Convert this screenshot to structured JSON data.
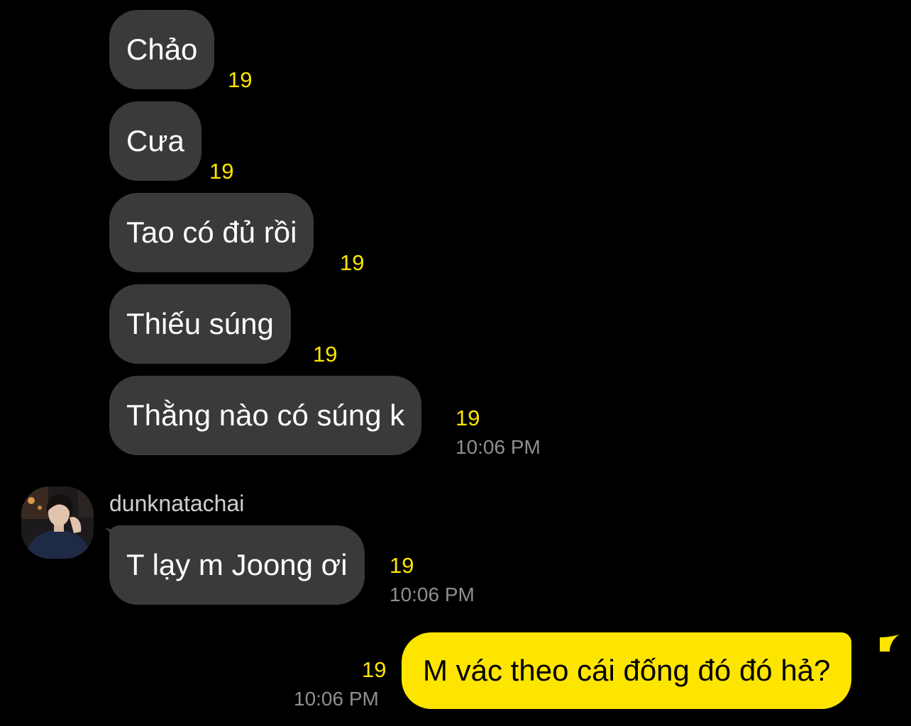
{
  "messages": [
    {
      "text": "Chảo",
      "unread": "19"
    },
    {
      "text": "Cưa",
      "unread": "19"
    },
    {
      "text": "Tao có đủ rồi",
      "unread": "19"
    },
    {
      "text": "Thiếu súng",
      "unread": "19"
    },
    {
      "text": "Thằng nào có súng k",
      "unread": "19",
      "time": "10:06 PM"
    },
    {
      "sender": "dunknatachai",
      "avatar_icon": "profile-photo-avatar",
      "text": "T lạy m Joong ơi",
      "unread": "19",
      "time": "10:06 PM"
    },
    {
      "text": "M vác theo cái đống đó đó hả?",
      "unread": "19",
      "time": "10:06 PM"
    }
  ],
  "colors": {
    "background": "#000000",
    "incoming_bubble": "#3a3a3c",
    "outgoing_bubble": "#fee500",
    "unread_count": "#fee500",
    "timestamp": "#8e8e93"
  }
}
